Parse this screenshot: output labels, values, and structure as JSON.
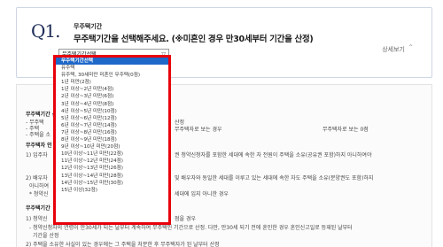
{
  "question": {
    "number": "Q1.",
    "category": "무주택기간",
    "title": "무주택기간을 선택해주세요. (※미혼인 경우 만30세부터 기간을 산정)",
    "detail_link": "상세보기",
    "detail_icon": "chevron-up-icon"
  },
  "select": {
    "current_value": "무주택기간선택"
  },
  "dropdown": {
    "options": [
      "무주택기간선택",
      "유주택",
      "유주택, 30세미만 미혼인 무주택(0점)",
      "1년 미만(2점)",
      "1년 이상~2년 미만(4점)",
      "2년 이상~3년 미만(6점)",
      "3년 이상~4년 미만(8점)",
      "4년 이상~5년 미만(10점)",
      "5년 이상~6년 미만(12점)",
      "6년 이상~7년 미만(14점)",
      "7년 이상~8년 미만(16점)",
      "8년 이상~9년 미만(18점)",
      "9년 이상~10년 미만(20점)",
      "10년 이상~11년 미만(22점)",
      "11년 이상~12년 미만(24점)",
      "12년 이상~13년 미만(26점)",
      "13년 이상~14년 미만(28점)",
      "14년 이상~15년 미만(30점)",
      "15년 이상(32점)"
    ],
    "selected_index": 0
  },
  "background": {
    "lines": [
      "무주택기간 산정",
      "- 무주택",
      "- 주택",
      "- 주택을 소",
      "산정",
      "무주택자로 보는 경우",
      "무주택자로 보는 0점",
      "무주택자 인",
      "1) 입주자",
      "권 청약신청자를 포함한 세대에 속한 자 전원이 주택을 소유(공유권 포함)하지 아니하여야",
      "2) 배우자",
      "및 배우자와 동일한 세대를 이루고 있는 세대에 속한 자도 주택을 소유(분양권도 포함)하지",
      "아니하여",
      "* 청약신",
      "세대에 입지 아니한 경우",
      "무주택기간",
      "1) 청약신",
      "점을 경우",
      "- 청약신청자의 연령이 만30세가 되는 날부터 계속하여 무주택인 기간으로 산정. 다만, 만30세 되기 전에 혼인한 경우 혼인신고일로 등재된 날부터",
      "기간을 산정",
      "2) 주택을 소유한 사실이 있는 경우에는 그 주택을 처분한 후 무주택자가 된 날부터 산정"
    ]
  }
}
